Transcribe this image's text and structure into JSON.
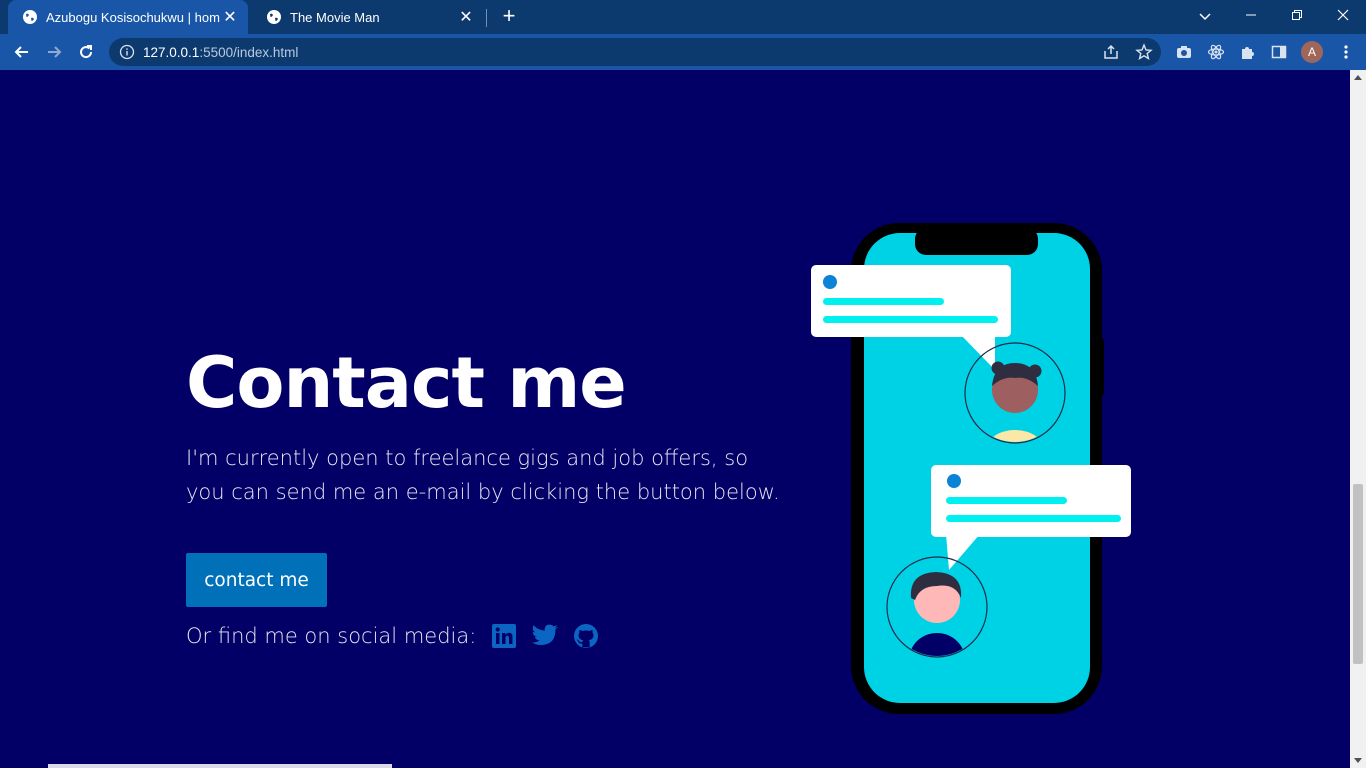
{
  "browser": {
    "tabs": [
      {
        "title": "Azubogu Kosisochukwu | home",
        "active": true,
        "icon": "globe-icon"
      },
      {
        "title": "The Movie Man",
        "active": false,
        "icon": "globe-icon"
      }
    ],
    "url": {
      "host": "127.0.0.1",
      "rest": ":5500/index.html"
    },
    "profile_initial": "A"
  },
  "contact": {
    "title": "Contact me",
    "description": "I'm currently open to freelance gigs and job offers, so you can send me an e-mail by clicking the button below.",
    "button_label": "contact me",
    "social_label": "Or find me on social media:",
    "social_icons": [
      "linkedin-icon",
      "twitter-icon",
      "github-icon"
    ]
  },
  "colors": {
    "page_background": "#020066",
    "button": "#0071b8",
    "social_icon": "#0a66c2",
    "phone_screen": "#00d2e6",
    "bubble_line": "#00f0f0",
    "bubble_dot": "#0a84d6"
  }
}
